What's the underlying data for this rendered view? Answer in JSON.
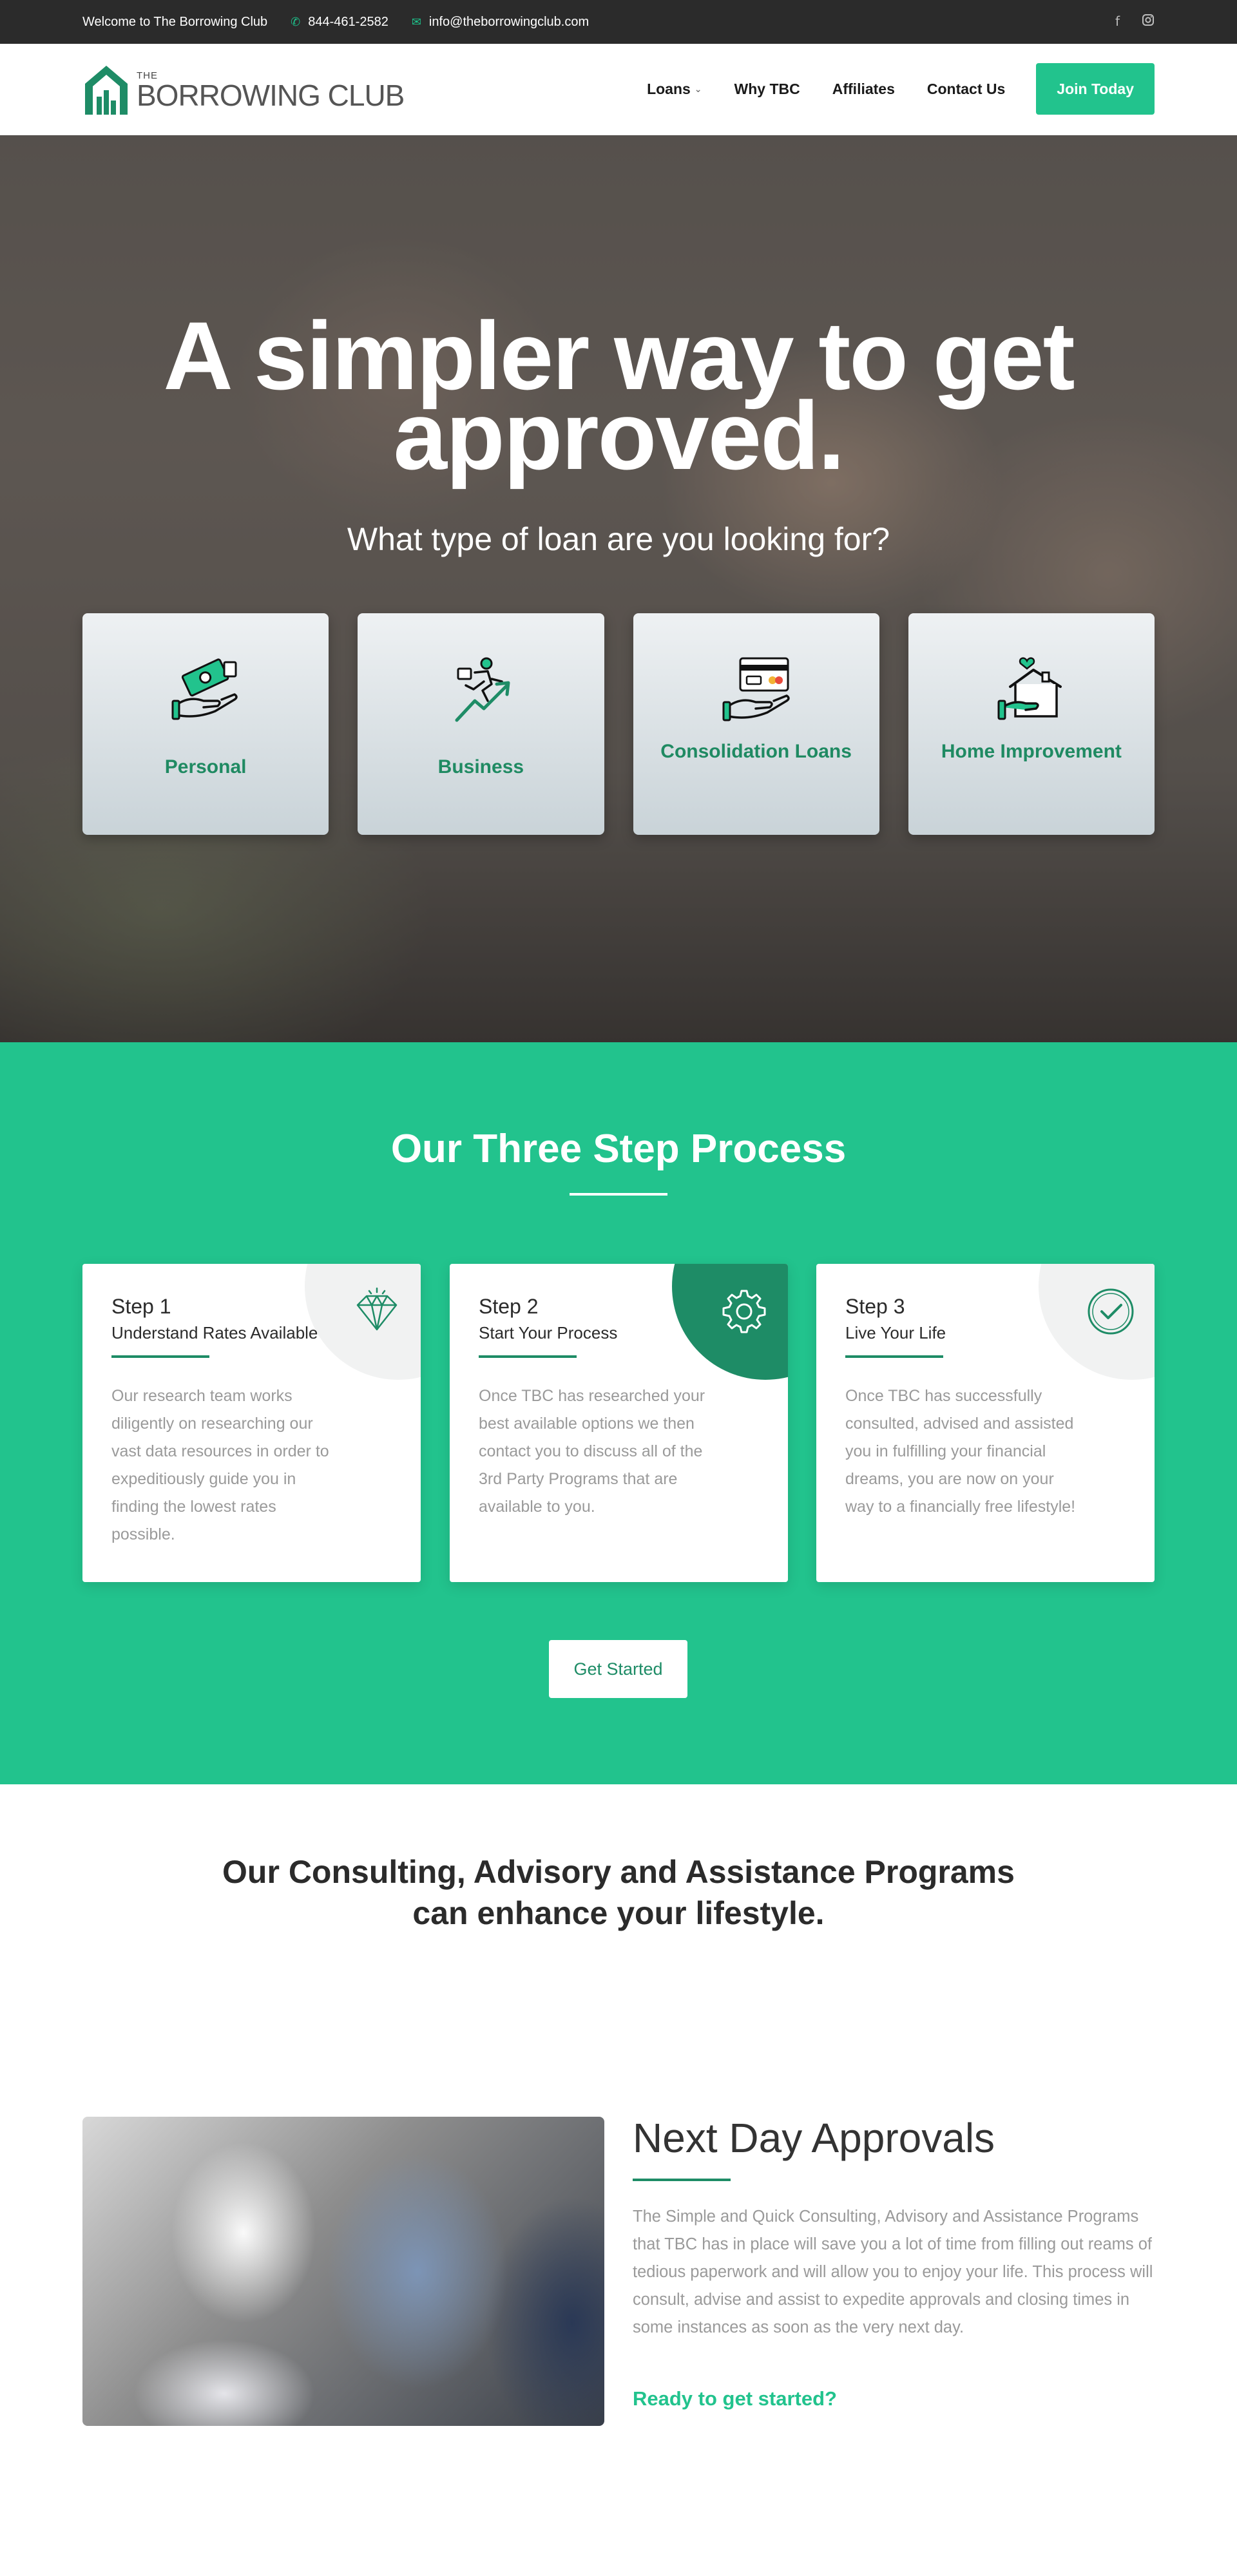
{
  "topbar": {
    "welcome": "Welcome to The Borrowing Club",
    "phone": "844-461-2582",
    "email": "info@theborrowingclub.com",
    "social": [
      "facebook-icon",
      "instagram-icon"
    ]
  },
  "header": {
    "logo_small": "THE",
    "logo_name": "BORROWING CLUB",
    "nav": [
      "Loans",
      "Why TBC",
      "Affiliates",
      "Contact Us"
    ],
    "join_label": "Join Today"
  },
  "hero": {
    "title": "A simpler way to get approved.",
    "subtitle": "What type of loan are you looking for?",
    "cards": [
      {
        "label": "Personal",
        "icon": "money-hand-icon"
      },
      {
        "label": "Business",
        "icon": "growth-runner-icon"
      },
      {
        "label": "Consolidation Loans",
        "icon": "card-hand-icon"
      },
      {
        "label": "Home Improvement",
        "icon": "house-hand-icon"
      }
    ]
  },
  "steps": {
    "heading": "Our Three Step Process",
    "items": [
      {
        "num": "Step 1",
        "title": "Understand Rates Available",
        "desc": "Our research team works diligently on researching our vast data resources in order to expeditiously guide you in finding the lowest rates possible.",
        "icon": "diamond-icon"
      },
      {
        "num": "Step 2",
        "title": "Start Your Process",
        "desc": "Once TBC has researched your best available options we then contact you to discuss all of the 3rd Party Programs that are available to you.",
        "icon": "gear-icon"
      },
      {
        "num": "Step 3",
        "title": "Live Your Life",
        "desc": "Once TBC has successfully consulted, advised and assisted you in fulfilling your financial dreams, you are now on your way to a financially free lifestyle!",
        "icon": "check-circle-icon"
      }
    ],
    "cta": "Get Started"
  },
  "programs": {
    "line1": "Our Consulting, Advisory and Assistance Programs",
    "line2": "can enhance your lifestyle."
  },
  "approvals": {
    "title": "Next Day Approvals",
    "desc": "The Simple and Quick Consulting, Advisory and Assistance Programs that TBC has in place will save you a lot of time from filling out reams of tedious paperwork and will allow you to enjoy your life. This process will consult, advise and assist to expedite approvals and closing times in some instances as soon as the very next day.",
    "cta": "Ready to get started?"
  },
  "colors": {
    "brand_green": "#22c38d",
    "dark_green": "#1e8c66",
    "topbar": "#2b2b2b"
  }
}
